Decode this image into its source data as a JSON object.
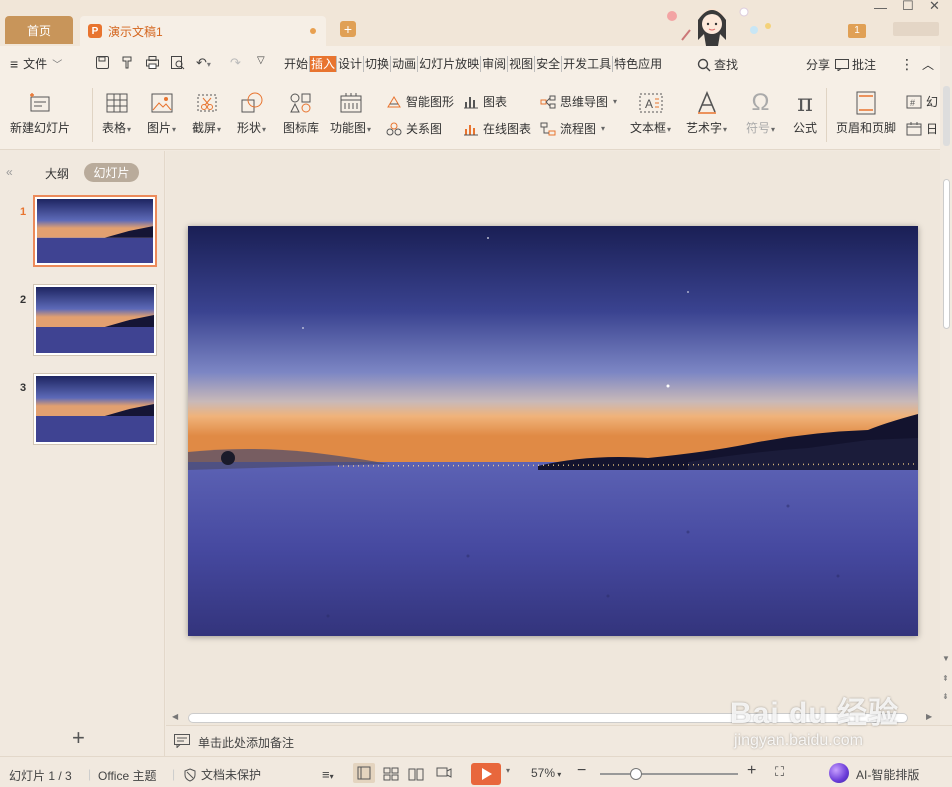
{
  "tabs": {
    "home": "首页",
    "doc": "演示文稿1",
    "page_badge": "1"
  },
  "menu": {
    "file": "文件",
    "tabs": [
      "开始",
      "插入",
      "设计",
      "切换",
      "动画",
      "幻灯片放映",
      "审阅",
      "视图",
      "安全",
      "开发工具",
      "特色应用"
    ],
    "active_tab": "插入",
    "find": "查找",
    "share": "分享",
    "comment": "批注"
  },
  "ribbon": {
    "new_slide": "新建幻灯片",
    "table": "表格",
    "picture": "图片",
    "screenshot": "截屏",
    "shape": "形状",
    "icon_lib": "图标库",
    "function_chart": "功能图",
    "smart_shape": "智能图形",
    "relation_chart": "关系图",
    "chart": "图表",
    "online_chart": "在线图表",
    "mind_map": "思维导图",
    "flowchart": "流程图",
    "textbox": "文本框",
    "wordart": "艺术字",
    "symbol": "符号",
    "formula": "公式",
    "header_footer": "页眉和页脚",
    "slide_num_partial": "幻",
    "date_partial": "日"
  },
  "left_panel": {
    "outline": "大纲",
    "slides": "幻灯片",
    "thumbnails": [
      "1",
      "2",
      "3"
    ]
  },
  "notes": {
    "placeholder": "单击此处添加备注"
  },
  "status": {
    "slide_info": "幻灯片 1 / 3",
    "theme": "Office 主题",
    "protect": "文档未保护",
    "zoom": "57%",
    "ai": "AI-智能排版"
  },
  "watermark": {
    "brand": "Bai du 经验",
    "url": "jingyan.baidu.com"
  },
  "colors": {
    "accent": "#e8742f",
    "home_tab": "#c8955a",
    "play": "#e8673c"
  }
}
